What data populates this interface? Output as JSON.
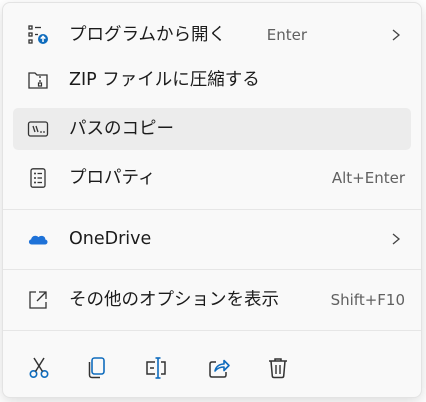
{
  "menu": {
    "items": [
      {
        "label": "プログラムから開く",
        "shortcut": "Enter",
        "icon": "open-with-icon",
        "submenu": true
      },
      {
        "label": "ZIP ファイルに圧縮する",
        "shortcut": "",
        "icon": "zip-folder-icon",
        "submenu": false
      },
      {
        "label": "パスのコピー",
        "shortcut": "",
        "icon": "copy-path-icon",
        "submenu": false
      },
      {
        "label": "プロパティ",
        "shortcut": "Alt+Enter",
        "icon": "properties-icon",
        "submenu": false
      },
      {
        "label": "OneDrive",
        "shortcut": "",
        "icon": "onedrive-cloud-icon",
        "submenu": true
      },
      {
        "label": "その他のオプションを表示",
        "shortcut": "Shift+F10",
        "icon": "more-options-icon",
        "submenu": false
      }
    ],
    "toolbar": [
      {
        "icon": "cut-icon"
      },
      {
        "icon": "copy-icon"
      },
      {
        "icon": "rename-icon"
      },
      {
        "icon": "share-icon"
      },
      {
        "icon": "delete-icon"
      }
    ],
    "colors": {
      "accent": "#0f6cbd",
      "onedrive_blue": "#1e72d8",
      "hover_background": "#ececec",
      "menu_background": "#f9f9f9"
    }
  }
}
